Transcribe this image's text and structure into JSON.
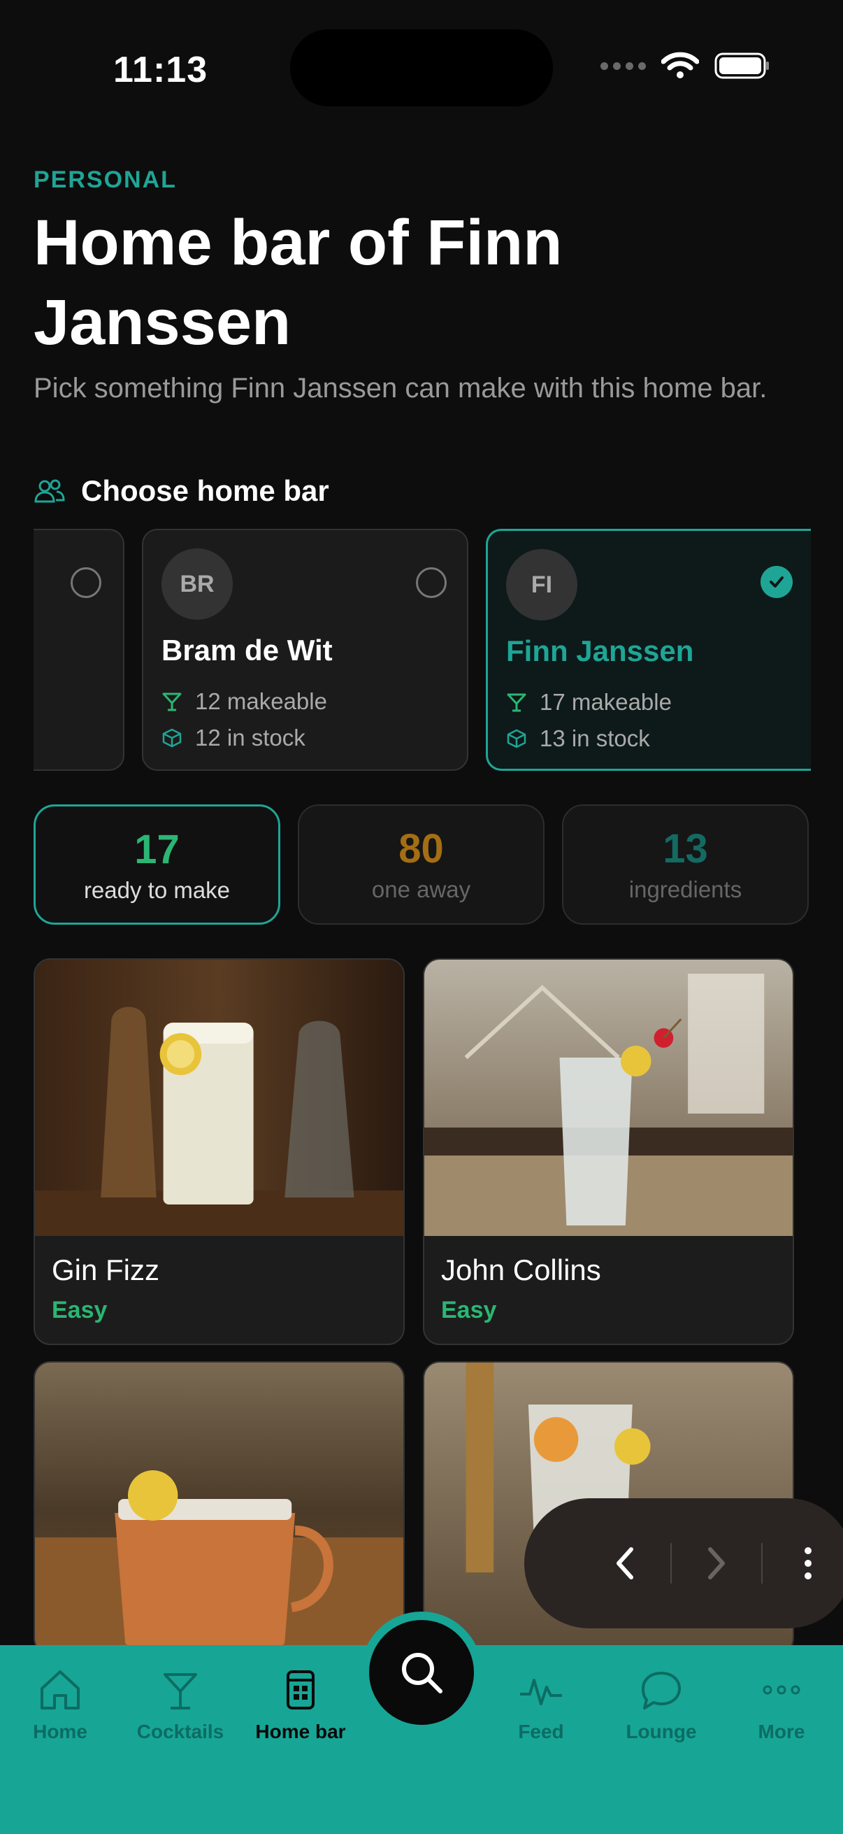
{
  "status": {
    "time": "11:13"
  },
  "header": {
    "eyebrow": "PERSONAL",
    "title": "Home bar of Finn Janssen",
    "subtitle": "Pick something Finn Janssen can make with this home bar."
  },
  "section": {
    "label": "Choose home bar"
  },
  "bars": [
    {
      "initials": "BR",
      "name": "Bram de Wit",
      "makeable": "12 makeable",
      "stock": "12 in stock",
      "selected": false
    },
    {
      "initials": "FI",
      "name": "Finn Janssen",
      "makeable": "17 makeable",
      "stock": "13 in stock",
      "selected": true
    }
  ],
  "stats": [
    {
      "value": "17",
      "label": "ready to make",
      "color": "#2bb673"
    },
    {
      "value": "80",
      "label": "one away",
      "color": "#a36e14"
    },
    {
      "value": "13",
      "label": "ingredients",
      "color": "#146a62"
    }
  ],
  "cocktails": [
    {
      "name": "Gin Fizz",
      "difficulty": "Easy"
    },
    {
      "name": "John Collins",
      "difficulty": "Easy"
    }
  ],
  "tabs": [
    {
      "label": "Home",
      "icon": "home-icon"
    },
    {
      "label": "Cocktails",
      "icon": "cocktail-icon"
    },
    {
      "label": "Home bar",
      "icon": "home-bar-icon",
      "active": true
    },
    {
      "label": "Feed",
      "icon": "pulse-icon"
    },
    {
      "label": "Lounge",
      "icon": "chat-bubble-icon"
    },
    {
      "label": "More",
      "icon": "more-dots-icon"
    }
  ],
  "colors": {
    "accent": "#1fa596",
    "tabbar": "#17a596",
    "easy": "#2bb673"
  }
}
